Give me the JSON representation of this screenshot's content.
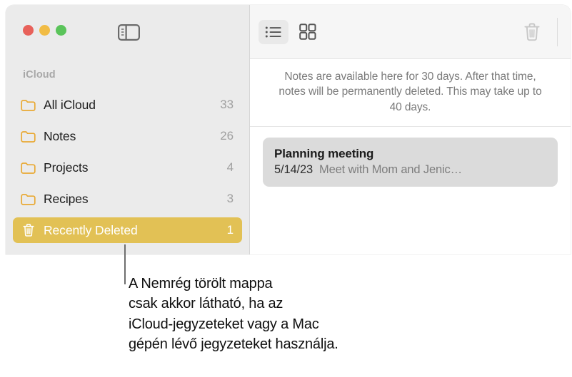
{
  "window": {
    "traffic_lights": [
      {
        "name": "close",
        "color": "#e8615a"
      },
      {
        "name": "minimize",
        "color": "#f1bc45"
      },
      {
        "name": "zoom",
        "color": "#5ac45a"
      }
    ],
    "sidebar_toggle_icon": "sidebar-toggle-icon"
  },
  "sidebar": {
    "section_title": "iCloud",
    "items": [
      {
        "icon": "folder-icon",
        "label": "All iCloud",
        "count": "33",
        "selected": false
      },
      {
        "icon": "folder-icon",
        "label": "Notes",
        "count": "26",
        "selected": false
      },
      {
        "icon": "folder-icon",
        "label": "Projects",
        "count": "4",
        "selected": false
      },
      {
        "icon": "folder-icon",
        "label": "Recipes",
        "count": "3",
        "selected": false
      },
      {
        "icon": "trash-icon",
        "label": "Recently Deleted",
        "count": "1",
        "selected": true
      }
    ],
    "selected_color": "#e2c155",
    "folder_icon_color": "#e9a933"
  },
  "toolbar": {
    "buttons": [
      {
        "icon": "list-view-icon",
        "label": "List View",
        "active": true
      },
      {
        "icon": "grid-view-icon",
        "label": "Gallery View",
        "active": false
      }
    ],
    "delete_button": {
      "icon": "trash-icon",
      "label": "Delete",
      "enabled": false
    }
  },
  "main": {
    "info_banner": "Notes are available here for 30 days. After that time, notes will be permanently deleted. This may take up to 40 days.",
    "notes": [
      {
        "title": "Planning meeting",
        "date": "5/14/23",
        "snippet": "Meet with Mom and Jenic…"
      }
    ]
  },
  "callout": {
    "lines": [
      "A Nemrég törölt mappa",
      "csak akkor látható, ha az",
      "iCloud-jegyzeteket vagy a Mac",
      "gépén lévő jegyzeteket használja."
    ]
  }
}
